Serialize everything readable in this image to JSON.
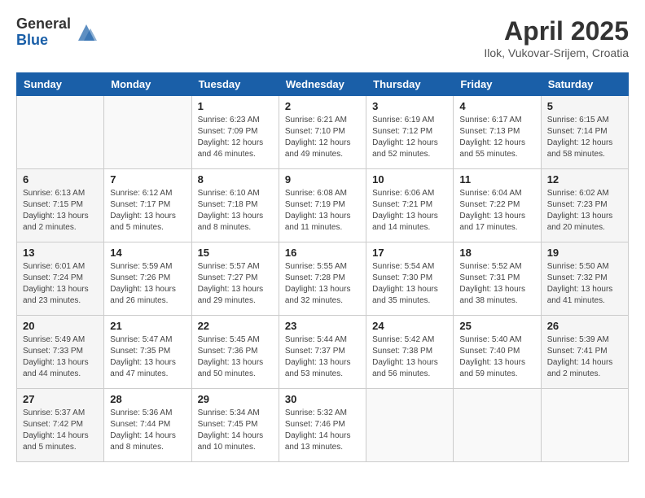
{
  "header": {
    "logo_general": "General",
    "logo_blue": "Blue",
    "title": "April 2025",
    "location": "Ilok, Vukovar-Srijem, Croatia"
  },
  "days_of_week": [
    "Sunday",
    "Monday",
    "Tuesday",
    "Wednesday",
    "Thursday",
    "Friday",
    "Saturday"
  ],
  "weeks": [
    [
      {
        "day": "",
        "info": ""
      },
      {
        "day": "",
        "info": ""
      },
      {
        "day": "1",
        "info": "Sunrise: 6:23 AM\nSunset: 7:09 PM\nDaylight: 12 hours\nand 46 minutes."
      },
      {
        "day": "2",
        "info": "Sunrise: 6:21 AM\nSunset: 7:10 PM\nDaylight: 12 hours\nand 49 minutes."
      },
      {
        "day": "3",
        "info": "Sunrise: 6:19 AM\nSunset: 7:12 PM\nDaylight: 12 hours\nand 52 minutes."
      },
      {
        "day": "4",
        "info": "Sunrise: 6:17 AM\nSunset: 7:13 PM\nDaylight: 12 hours\nand 55 minutes."
      },
      {
        "day": "5",
        "info": "Sunrise: 6:15 AM\nSunset: 7:14 PM\nDaylight: 12 hours\nand 58 minutes."
      }
    ],
    [
      {
        "day": "6",
        "info": "Sunrise: 6:13 AM\nSunset: 7:15 PM\nDaylight: 13 hours\nand 2 minutes."
      },
      {
        "day": "7",
        "info": "Sunrise: 6:12 AM\nSunset: 7:17 PM\nDaylight: 13 hours\nand 5 minutes."
      },
      {
        "day": "8",
        "info": "Sunrise: 6:10 AM\nSunset: 7:18 PM\nDaylight: 13 hours\nand 8 minutes."
      },
      {
        "day": "9",
        "info": "Sunrise: 6:08 AM\nSunset: 7:19 PM\nDaylight: 13 hours\nand 11 minutes."
      },
      {
        "day": "10",
        "info": "Sunrise: 6:06 AM\nSunset: 7:21 PM\nDaylight: 13 hours\nand 14 minutes."
      },
      {
        "day": "11",
        "info": "Sunrise: 6:04 AM\nSunset: 7:22 PM\nDaylight: 13 hours\nand 17 minutes."
      },
      {
        "day": "12",
        "info": "Sunrise: 6:02 AM\nSunset: 7:23 PM\nDaylight: 13 hours\nand 20 minutes."
      }
    ],
    [
      {
        "day": "13",
        "info": "Sunrise: 6:01 AM\nSunset: 7:24 PM\nDaylight: 13 hours\nand 23 minutes."
      },
      {
        "day": "14",
        "info": "Sunrise: 5:59 AM\nSunset: 7:26 PM\nDaylight: 13 hours\nand 26 minutes."
      },
      {
        "day": "15",
        "info": "Sunrise: 5:57 AM\nSunset: 7:27 PM\nDaylight: 13 hours\nand 29 minutes."
      },
      {
        "day": "16",
        "info": "Sunrise: 5:55 AM\nSunset: 7:28 PM\nDaylight: 13 hours\nand 32 minutes."
      },
      {
        "day": "17",
        "info": "Sunrise: 5:54 AM\nSunset: 7:30 PM\nDaylight: 13 hours\nand 35 minutes."
      },
      {
        "day": "18",
        "info": "Sunrise: 5:52 AM\nSunset: 7:31 PM\nDaylight: 13 hours\nand 38 minutes."
      },
      {
        "day": "19",
        "info": "Sunrise: 5:50 AM\nSunset: 7:32 PM\nDaylight: 13 hours\nand 41 minutes."
      }
    ],
    [
      {
        "day": "20",
        "info": "Sunrise: 5:49 AM\nSunset: 7:33 PM\nDaylight: 13 hours\nand 44 minutes."
      },
      {
        "day": "21",
        "info": "Sunrise: 5:47 AM\nSunset: 7:35 PM\nDaylight: 13 hours\nand 47 minutes."
      },
      {
        "day": "22",
        "info": "Sunrise: 5:45 AM\nSunset: 7:36 PM\nDaylight: 13 hours\nand 50 minutes."
      },
      {
        "day": "23",
        "info": "Sunrise: 5:44 AM\nSunset: 7:37 PM\nDaylight: 13 hours\nand 53 minutes."
      },
      {
        "day": "24",
        "info": "Sunrise: 5:42 AM\nSunset: 7:38 PM\nDaylight: 13 hours\nand 56 minutes."
      },
      {
        "day": "25",
        "info": "Sunrise: 5:40 AM\nSunset: 7:40 PM\nDaylight: 13 hours\nand 59 minutes."
      },
      {
        "day": "26",
        "info": "Sunrise: 5:39 AM\nSunset: 7:41 PM\nDaylight: 14 hours\nand 2 minutes."
      }
    ],
    [
      {
        "day": "27",
        "info": "Sunrise: 5:37 AM\nSunset: 7:42 PM\nDaylight: 14 hours\nand 5 minutes."
      },
      {
        "day": "28",
        "info": "Sunrise: 5:36 AM\nSunset: 7:44 PM\nDaylight: 14 hours\nand 8 minutes."
      },
      {
        "day": "29",
        "info": "Sunrise: 5:34 AM\nSunset: 7:45 PM\nDaylight: 14 hours\nand 10 minutes."
      },
      {
        "day": "30",
        "info": "Sunrise: 5:32 AM\nSunset: 7:46 PM\nDaylight: 14 hours\nand 13 minutes."
      },
      {
        "day": "",
        "info": ""
      },
      {
        "day": "",
        "info": ""
      },
      {
        "day": "",
        "info": ""
      }
    ]
  ]
}
